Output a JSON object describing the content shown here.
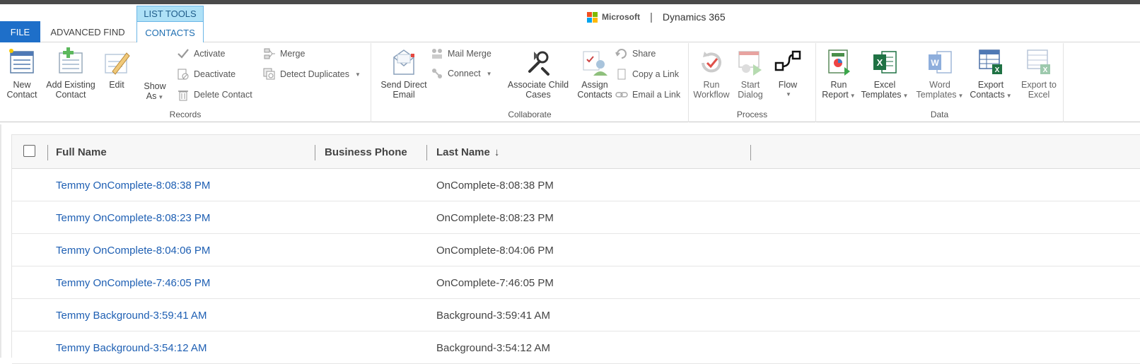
{
  "brand": {
    "company": "Microsoft",
    "product": "Dynamics 365"
  },
  "tabs": {
    "file": "FILE",
    "advanced_find": "ADVANCED FIND",
    "context_group": "LIST TOOLS",
    "contacts": "CONTACTS"
  },
  "ribbon": {
    "records": {
      "label": "Records",
      "new_contact": [
        "New",
        "Contact"
      ],
      "add_existing": [
        "Add Existing",
        "Contact"
      ],
      "edit": "Edit",
      "show_as": [
        "Show",
        "As"
      ],
      "activate": "Activate",
      "deactivate": "Deactivate",
      "delete": "Delete Contact",
      "merge": "Merge",
      "detect_duplicates": "Detect Duplicates"
    },
    "collaborate": {
      "label": "Collaborate",
      "send_email": [
        "Send Direct",
        "Email"
      ],
      "mail_merge": "Mail Merge",
      "connect": "Connect",
      "associate": [
        "Associate Child",
        "Cases"
      ],
      "assign": [
        "Assign",
        "Contacts"
      ],
      "share": "Share",
      "copy_link": "Copy a Link",
      "email_link": "Email a Link"
    },
    "process": {
      "label": "Process",
      "run_workflow": [
        "Run",
        "Workflow"
      ],
      "start_dialog": [
        "Start",
        "Dialog"
      ],
      "flow": "Flow"
    },
    "data": {
      "label": "Data",
      "run_report": [
        "Run",
        "Report"
      ],
      "excel_templates": [
        "Excel",
        "Templates"
      ],
      "word_templates": [
        "Word",
        "Templates"
      ],
      "export_contacts": [
        "Export",
        "Contacts"
      ],
      "export_excel": [
        "Export to",
        "Excel"
      ]
    }
  },
  "grid": {
    "columns": {
      "full_name": "Full Name",
      "business_phone": "Business Phone",
      "last_name": "Last Name"
    },
    "sort_indicator": "↓",
    "rows": [
      {
        "full_name": "Temmy OnComplete-8:08:38 PM",
        "last_name": "OnComplete-8:08:38 PM"
      },
      {
        "full_name": "Temmy OnComplete-8:08:23 PM",
        "last_name": "OnComplete-8:08:23 PM"
      },
      {
        "full_name": "Temmy OnComplete-8:04:06 PM",
        "last_name": "OnComplete-8:04:06 PM"
      },
      {
        "full_name": "Temmy OnComplete-7:46:05 PM",
        "last_name": "OnComplete-7:46:05 PM"
      },
      {
        "full_name": "Temmy Background-3:59:41 AM",
        "last_name": "Background-3:59:41 AM"
      },
      {
        "full_name": "Temmy Background-3:54:12 AM",
        "last_name": "Background-3:54:12 AM"
      }
    ]
  },
  "colors": {
    "accent": "#1e6fc9",
    "link": "#1e5fb3",
    "context_tab": "#aee1f7"
  }
}
